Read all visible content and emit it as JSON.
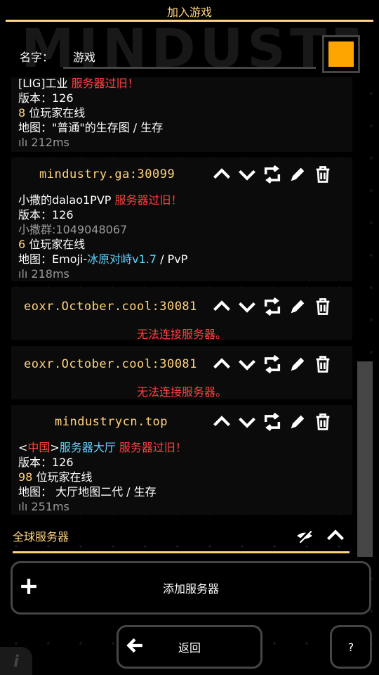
{
  "header": {
    "title": "加入游戏",
    "bg_logo": "MINDUSTRY"
  },
  "name_field": {
    "label": "名字：",
    "value": "游戏",
    "color": "#ffa500"
  },
  "servers": [
    {
      "host": "",
      "lines": [
        [
          {
            "t": "[LIG]工业",
            "c": ""
          },
          {
            "t": "    服务器过旧！",
            "c": "red"
          }
        ],
        [
          {
            "t": "版本：126",
            "c": ""
          }
        ],
        [
          {
            "t": "8",
            "c": "y"
          },
          {
            "t": " 位玩家在线",
            "c": ""
          }
        ],
        [
          {
            "t": "地图：\"普通\"的生存图 / 生存",
            "c": ""
          }
        ],
        [
          {
            "t": "ılı 212ms",
            "c": "ping"
          }
        ]
      ]
    },
    {
      "host": "mindustry.ga:30099",
      "lines": [
        [
          {
            "t": "小撒的dalao1PVP",
            "c": ""
          },
          {
            "t": "    服务器过旧！",
            "c": "red"
          }
        ],
        [
          {
            "t": "版本：126",
            "c": ""
          }
        ],
        [
          {
            "t": "小撒群:1049048067",
            "c": "g"
          }
        ],
        [
          {
            "t": "6",
            "c": "y"
          },
          {
            "t": " 位玩家在线",
            "c": ""
          }
        ],
        [
          {
            "t": "地图：Emoji-",
            "c": ""
          },
          {
            "t": "冰原对峙v1.7",
            "c": "cyan"
          },
          {
            "t": " / PvP",
            "c": ""
          }
        ],
        [
          {
            "t": "ılı 218ms",
            "c": "ping"
          }
        ]
      ]
    },
    {
      "host": "eoxr.October.cool:30081",
      "error": "无法连接服务器。"
    },
    {
      "host": "eoxr.October.cool:30081",
      "error": "无法连接服务器。"
    },
    {
      "host": "mindustrycn.top",
      "lines": [
        [
          {
            "t": "<",
            "c": ""
          },
          {
            "t": "中国",
            "c": "red"
          },
          {
            "t": ">",
            "c": ""
          },
          {
            "t": "服务器大厅",
            "c": "cyan"
          },
          {
            "t": "    服务器过旧！",
            "c": "red"
          }
        ],
        [
          {
            "t": "版本：126",
            "c": ""
          }
        ],
        [
          {
            "t": "98",
            "c": "y"
          },
          {
            "t": " 位玩家在线",
            "c": ""
          }
        ],
        [
          {
            "t": "地图： 大厅地图二代 / 生存",
            "c": ""
          }
        ],
        [
          {
            "t": "ılı 251ms",
            "c": "ping"
          }
        ]
      ]
    }
  ],
  "global_section": {
    "title": "全球服务器"
  },
  "buttons": {
    "add_server": "添加服务器",
    "back": "返回",
    "help": "?"
  },
  "icons": [
    "move-up-icon",
    "move-down-icon",
    "refresh-icon",
    "edit-icon",
    "delete-icon",
    "eye-off-icon",
    "collapse-icon",
    "plus-icon",
    "arrow-left-icon",
    "info-icon"
  ],
  "colors": {
    "accent": "#ffd37f",
    "error": "#ff4040",
    "highlight": "#5fd3ff",
    "panel": "#0b0b0b",
    "border": "#454545"
  }
}
